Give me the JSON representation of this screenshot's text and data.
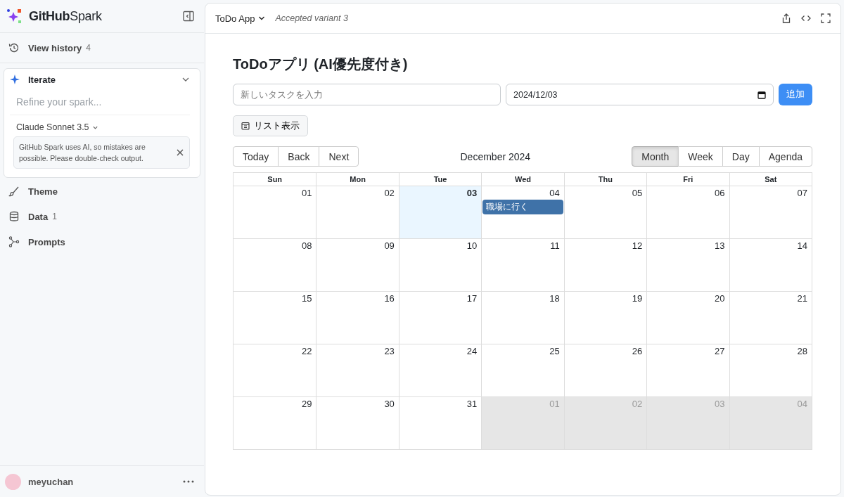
{
  "sidebar": {
    "brand": {
      "bold": "GitHub",
      "light": "Spark"
    },
    "history": {
      "label": "View history",
      "count": "4"
    },
    "iterate": {
      "title": "Iterate",
      "expanded": true,
      "placeholder": "Refine your spark...",
      "model": "Claude Sonnet 3.5",
      "notice": "GitHub Spark uses AI, so mistakes are possible. Please double-check output."
    },
    "items": [
      {
        "kind": "theme",
        "label": "Theme"
      },
      {
        "kind": "data",
        "label": "Data",
        "count": "1"
      },
      {
        "kind": "prompts",
        "label": "Prompts"
      }
    ],
    "user": "meyuchan"
  },
  "header": {
    "app": "ToDo App",
    "variant": "Accepted variant 3"
  },
  "app": {
    "title": "ToDoアプリ (AI優先度付き)",
    "task_placeholder": "新しいタスクを入力",
    "date": "2024/12/03",
    "add": "追加",
    "list_view": "リスト表示",
    "nav": [
      "Today",
      "Back",
      "Next"
    ],
    "period": "December 2024",
    "views": [
      {
        "label": "Month",
        "selected": true
      },
      {
        "label": "Week",
        "selected": false
      },
      {
        "label": "Day",
        "selected": false
      },
      {
        "label": "Agenda",
        "selected": false
      }
    ],
    "weekdays": [
      "Sun",
      "Mon",
      "Tue",
      "Wed",
      "Thu",
      "Fri",
      "Sat"
    ],
    "weeks": [
      [
        {
          "day": "01"
        },
        {
          "day": "02"
        },
        {
          "day": "03",
          "today": true
        },
        {
          "day": "04",
          "events": [
            "職場に行く"
          ]
        },
        {
          "day": "05"
        },
        {
          "day": "06"
        },
        {
          "day": "07"
        }
      ],
      [
        {
          "day": "08"
        },
        {
          "day": "09"
        },
        {
          "day": "10"
        },
        {
          "day": "11"
        },
        {
          "day": "12"
        },
        {
          "day": "13"
        },
        {
          "day": "14"
        }
      ],
      [
        {
          "day": "15"
        },
        {
          "day": "16"
        },
        {
          "day": "17"
        },
        {
          "day": "18"
        },
        {
          "day": "19"
        },
        {
          "day": "20"
        },
        {
          "day": "21"
        }
      ],
      [
        {
          "day": "22"
        },
        {
          "day": "23"
        },
        {
          "day": "24"
        },
        {
          "day": "25"
        },
        {
          "day": "26"
        },
        {
          "day": "27"
        },
        {
          "day": "28"
        }
      ],
      [
        {
          "day": "29"
        },
        {
          "day": "30"
        },
        {
          "day": "31"
        },
        {
          "day": "01",
          "off_range": true
        },
        {
          "day": "02",
          "off_range": true
        },
        {
          "day": "03",
          "off_range": true
        },
        {
          "day": "04",
          "off_range": true
        }
      ]
    ]
  }
}
